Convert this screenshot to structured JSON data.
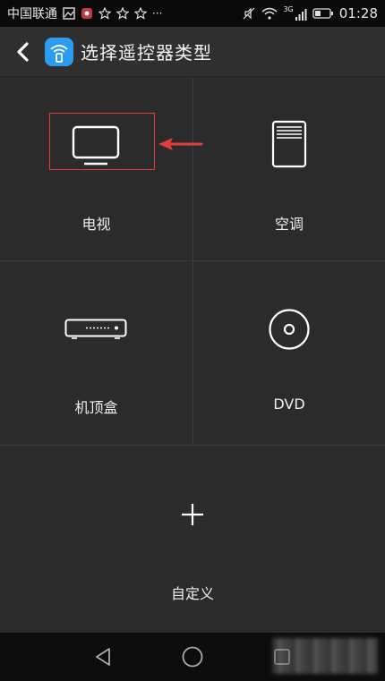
{
  "status_bar": {
    "carrier": "中国联通",
    "network": "3G",
    "time": "01:28"
  },
  "header": {
    "title": "选择遥控器类型",
    "back_icon": "chevron-left-icon",
    "app_icon": "wifi-remote-icon"
  },
  "device_types": [
    {
      "label": "电视",
      "icon": "tv-icon"
    },
    {
      "label": "空调",
      "icon": "air-conditioner-icon"
    },
    {
      "label": "机顶盒",
      "icon": "set-top-box-icon"
    },
    {
      "label": "DVD",
      "icon": "disc-icon"
    }
  ],
  "custom": {
    "label": "自定义",
    "icon": "plus-icon"
  },
  "colors": {
    "highlight": "#e23c3c",
    "app_accent": "#2b9cf0"
  }
}
